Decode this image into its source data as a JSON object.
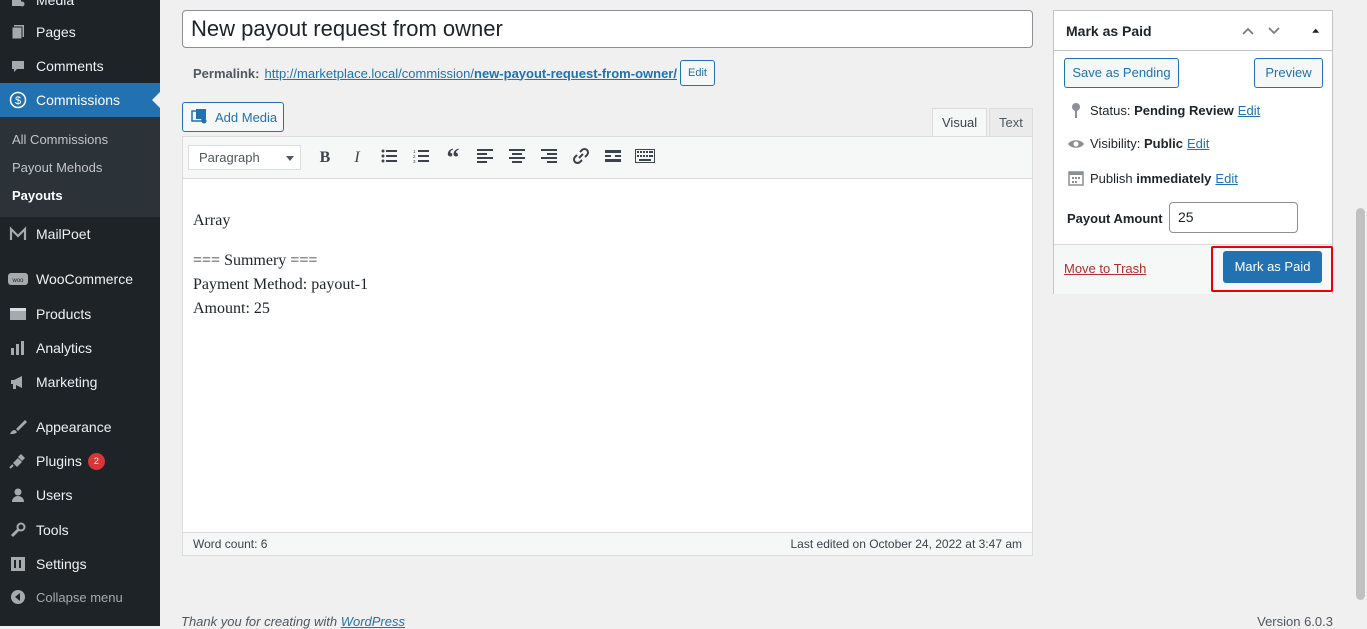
{
  "sidebar": {
    "items": [
      {
        "label": "Media",
        "icon": "media-icon"
      },
      {
        "label": "Pages",
        "icon": "pages-icon"
      },
      {
        "label": "Comments",
        "icon": "comments-icon"
      },
      {
        "label": "Commissions",
        "icon": "dollar-icon"
      },
      {
        "label": "MailPoet",
        "icon": "mailpoet-icon"
      },
      {
        "label": "WooCommerce",
        "icon": "woocommerce-icon"
      },
      {
        "label": "Products",
        "icon": "products-icon"
      },
      {
        "label": "Analytics",
        "icon": "analytics-icon"
      },
      {
        "label": "Marketing",
        "icon": "megaphone-icon"
      },
      {
        "label": "Appearance",
        "icon": "brush-icon"
      },
      {
        "label": "Plugins",
        "icon": "plugin-icon",
        "badge": "2"
      },
      {
        "label": "Users",
        "icon": "users-icon"
      },
      {
        "label": "Tools",
        "icon": "tools-icon"
      },
      {
        "label": "Settings",
        "icon": "settings-icon"
      },
      {
        "label": "Collapse menu",
        "icon": "collapse-icon"
      }
    ],
    "submenu": [
      "All Commissions",
      "Payout Mehods",
      "Payouts"
    ]
  },
  "editor": {
    "title": "New payout request from owner",
    "permalink_label": "Permalink:",
    "permalink_base": "http://marketplace.local/commission/",
    "permalink_slug": "new-payout-request-from-owner/",
    "edit_label": "Edit",
    "add_media": "Add Media",
    "tab_visual": "Visual",
    "tab_text": "Text",
    "format": "Paragraph",
    "content": [
      "Array",
      "=== Summery ===",
      "Payment Method: payout-1",
      "Amount: 25"
    ],
    "word_count": "Word count: 6",
    "last_edited": "Last edited on October 24, 2022 at 3:47 am"
  },
  "publish": {
    "title": "Mark as Paid",
    "save_pending": "Save as Pending",
    "preview": "Preview",
    "status_label": "Status:",
    "status_value": "Pending Review",
    "visibility_label": "Visibility:",
    "visibility_value": "Public",
    "publish_label": "Publish",
    "publish_value": "immediately",
    "edit": "Edit",
    "payout_label": "Payout Amount",
    "payout_value": "25",
    "trash": "Move to Trash",
    "mark_paid": "Mark as Paid"
  },
  "footer": {
    "thanks": "Thank you for creating with",
    "wp_link": "WordPress",
    "version": "Version 6.0.3"
  },
  "colors": {
    "accent": "#2271b1",
    "sidebar_bg": "#1d2327",
    "highlight": "#e00000"
  }
}
